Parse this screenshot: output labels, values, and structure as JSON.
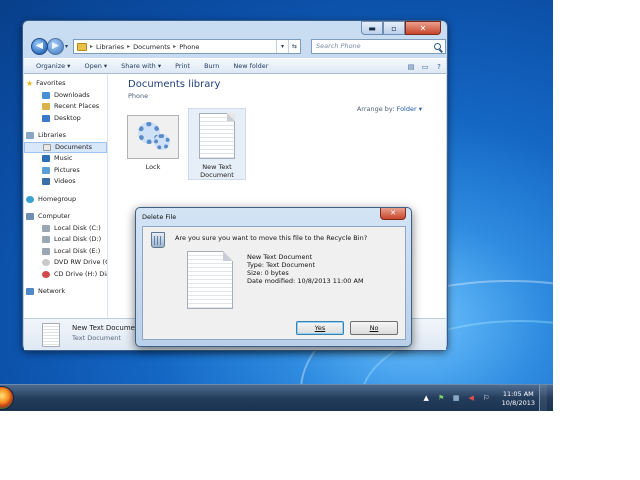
{
  "explorer": {
    "window_controls": {
      "minimize": "▬",
      "maximize": "▫",
      "close": "✕"
    },
    "breadcrumb": [
      "Libraries",
      "Documents",
      "Phone"
    ],
    "search_placeholder": "Search Phone",
    "toolbar": {
      "organize": "Organize ▾",
      "open": "Open ▾",
      "share_with": "Share with ▾",
      "print": "Print",
      "burn": "Burn",
      "new_folder": "New folder"
    },
    "nav_pane": {
      "favorites": {
        "label": "Favorites",
        "items": [
          "Downloads",
          "Recent Places",
          "Desktop"
        ]
      },
      "libraries": {
        "label": "Libraries",
        "items": [
          "Documents",
          "Music",
          "Pictures",
          "Videos"
        ]
      },
      "homegroup": "Homegroup",
      "computer": {
        "label": "Computer",
        "items": [
          "Local Disk (C:)",
          "Local Disk (D:)",
          "Local Disk (E:)",
          "DVD RW Drive (G:)",
          "CD Drive (H:) Dia"
        ]
      },
      "network": "Network"
    },
    "library_title": "Documents library",
    "library_subtitle": "Phone",
    "arrange_by_label": "Arrange by:",
    "arrange_by_value": "Folder ▾",
    "files": [
      {
        "name": "Lock",
        "icon": "gear-icon"
      },
      {
        "name": "New Text Document",
        "icon": "text-document-icon"
      }
    ],
    "details": {
      "name": "New Text Document",
      "type": "Text Document"
    }
  },
  "dialog": {
    "title": "Delete File",
    "close": "✕",
    "question": "Are you sure you want to move this file to the Recycle Bin?",
    "file_name": "New Text Document",
    "file_type": "Type: Text Document",
    "file_size": "Size: 0 bytes",
    "date_modified": "Date modified: 10/8/2013 11:00 AM",
    "yes_label": "Yes",
    "no_label": "No"
  },
  "taskbar": {
    "time": "11:05 AM",
    "date": "10/8/2013"
  }
}
